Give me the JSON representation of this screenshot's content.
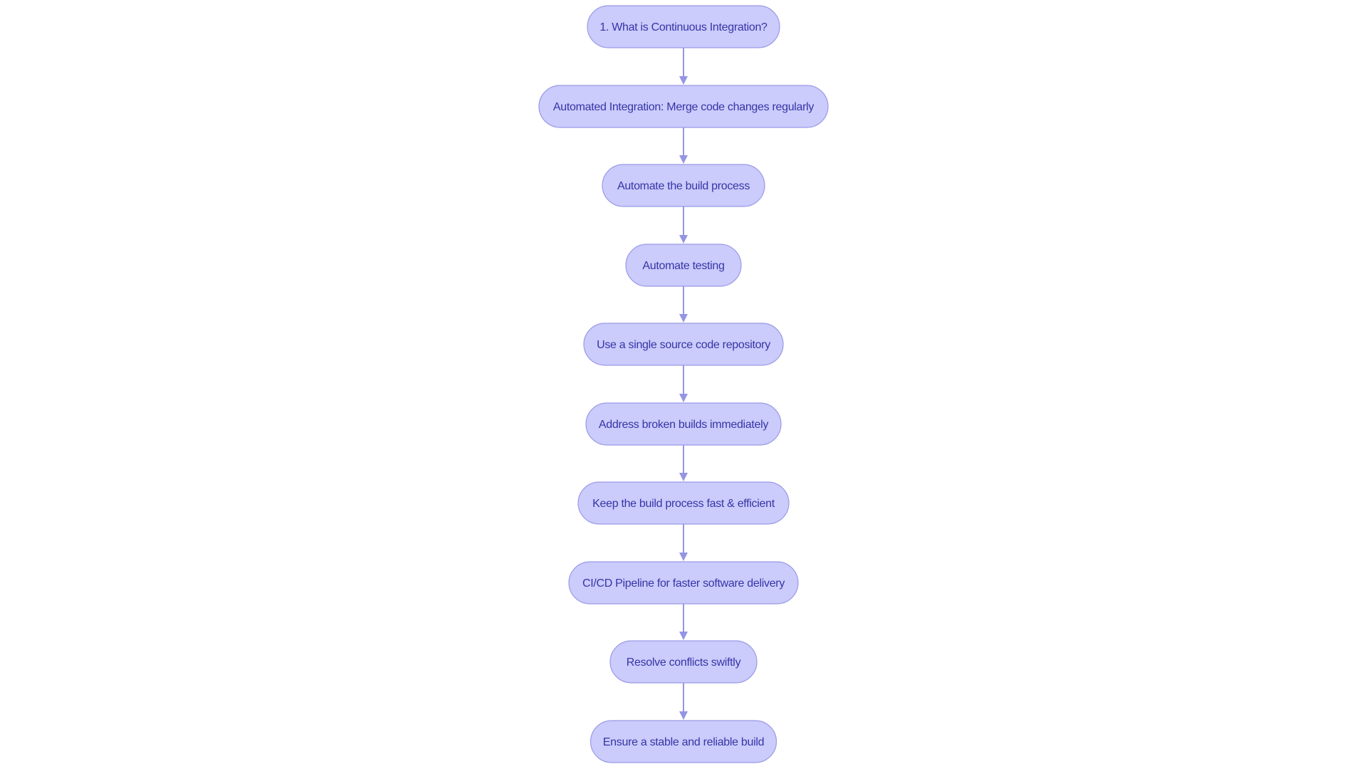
{
  "diagram": {
    "type": "flowchart",
    "direction": "top-to-bottom",
    "colors": {
      "node_fill": "#cbcbfc",
      "node_stroke": "#9a9ae6",
      "text": "#3535a6",
      "edge": "#9595e4"
    },
    "nodes": [
      {
        "id": "n1",
        "label": "1. What is Continuous Integration?"
      },
      {
        "id": "n2",
        "label": "Automated Integration: Merge code changes regularly"
      },
      {
        "id": "n3",
        "label": "Automate the build process"
      },
      {
        "id": "n4",
        "label": "Automate testing"
      },
      {
        "id": "n5",
        "label": "Use a single source code repository"
      },
      {
        "id": "n6",
        "label": "Address broken builds immediately"
      },
      {
        "id": "n7",
        "label": "Keep the build process fast & efficient"
      },
      {
        "id": "n8",
        "label": "CI/CD Pipeline for faster software delivery"
      },
      {
        "id": "n9",
        "label": "Resolve conflicts swiftly"
      },
      {
        "id": "n10",
        "label": "Ensure a stable and reliable build"
      }
    ],
    "edges": [
      {
        "from": "n1",
        "to": "n2"
      },
      {
        "from": "n2",
        "to": "n3"
      },
      {
        "from": "n3",
        "to": "n4"
      },
      {
        "from": "n4",
        "to": "n5"
      },
      {
        "from": "n5",
        "to": "n6"
      },
      {
        "from": "n6",
        "to": "n7"
      },
      {
        "from": "n7",
        "to": "n8"
      },
      {
        "from": "n8",
        "to": "n9"
      },
      {
        "from": "n9",
        "to": "n10"
      }
    ]
  }
}
